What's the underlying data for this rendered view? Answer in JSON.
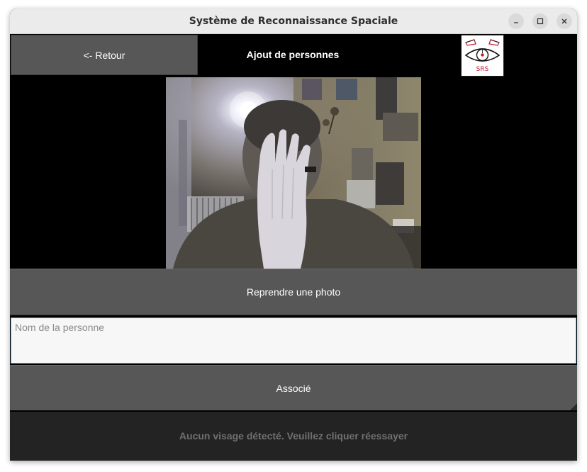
{
  "window": {
    "title": "Système de Reconnaissance Spaciale"
  },
  "header": {
    "back_label": "<- Retour",
    "page_title": "Ajout de personnes",
    "logo_text": "SRS"
  },
  "actions": {
    "retake_label": "Reprendre une photo",
    "associate_label": "Associé"
  },
  "form": {
    "name_placeholder": "Nom de la personne",
    "name_value": ""
  },
  "status": {
    "message": "Aucun visage détecté. Veuillez cliquer réessayer"
  },
  "icons": {
    "minimize": "minimize-icon",
    "maximize": "maximize-icon",
    "close": "close-icon",
    "logo": "eye-logo"
  },
  "colors": {
    "background": "#000000",
    "button": "#575757",
    "status_bar": "#232323",
    "status_text": "#707070",
    "input_border": "#7aa7c8",
    "logo_accent": "#c0172f"
  }
}
